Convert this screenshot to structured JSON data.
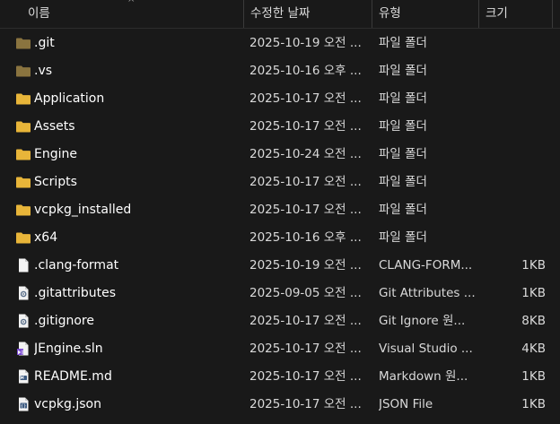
{
  "header": {
    "name": "이름",
    "date": "수정한 날짜",
    "type": "유형",
    "size": "크기",
    "sort_glyph": "^"
  },
  "rows": [
    {
      "name": ".git",
      "date": "2025-10-19 오전 ...",
      "type": "파일 폴더",
      "size": "",
      "icon": "folder-icon-dim"
    },
    {
      "name": ".vs",
      "date": "2025-10-16 오후 ...",
      "type": "파일 폴더",
      "size": "",
      "icon": "folder-icon-dim"
    },
    {
      "name": "Application",
      "date": "2025-10-17 오전 ...",
      "type": "파일 폴더",
      "size": "",
      "icon": "folder-icon"
    },
    {
      "name": "Assets",
      "date": "2025-10-17 오전 ...",
      "type": "파일 폴더",
      "size": "",
      "icon": "folder-icon"
    },
    {
      "name": "Engine",
      "date": "2025-10-24 오전 ...",
      "type": "파일 폴더",
      "size": "",
      "icon": "folder-icon"
    },
    {
      "name": "Scripts",
      "date": "2025-10-17 오전 ...",
      "type": "파일 폴더",
      "size": "",
      "icon": "folder-icon"
    },
    {
      "name": "vcpkg_installed",
      "date": "2025-10-17 오전 ...",
      "type": "파일 폴더",
      "size": "",
      "icon": "folder-icon"
    },
    {
      "name": "x64",
      "date": "2025-10-16 오후 ...",
      "type": "파일 폴더",
      "size": "",
      "icon": "folder-icon"
    },
    {
      "name": ".clang-format",
      "date": "2025-10-19 오전 ...",
      "type": "CLANG-FORM...",
      "size": "1KB",
      "icon": "file-icon"
    },
    {
      "name": ".gitattributes",
      "date": "2025-09-05 오전 ...",
      "type": "Git Attributes ...",
      "size": "1KB",
      "icon": "gear-file-icon"
    },
    {
      "name": ".gitignore",
      "date": "2025-10-17 오전 ...",
      "type": "Git Ignore 원...",
      "size": "8KB",
      "icon": "gear-file-icon"
    },
    {
      "name": "JEngine.sln",
      "date": "2025-10-17 오전 ...",
      "type": "Visual Studio ...",
      "size": "4KB",
      "icon": "visual-studio-file-icon"
    },
    {
      "name": "README.md",
      "date": "2025-10-17 오전 ...",
      "type": "Markdown 원...",
      "size": "1KB",
      "icon": "markdown-file-icon"
    },
    {
      "name": "vcpkg.json",
      "date": "2025-10-17 오전 ...",
      "type": "JSON File",
      "size": "1KB",
      "icon": "json-file-icon"
    }
  ],
  "colors": {
    "background": "#191919",
    "folder": "#e8b53a",
    "folder_dim": "#8a7440",
    "text": "#ffffff"
  }
}
